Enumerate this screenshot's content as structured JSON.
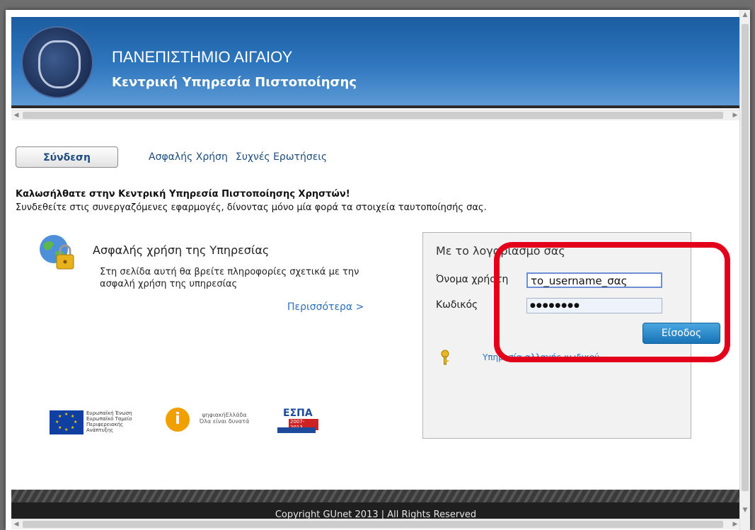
{
  "header": {
    "title": "ΠΑΝΕΠΙΣΤΗΜΙΟ ΑΙΓΑΙΟΥ",
    "subtitle": "Κεντρική Υπηρεσία Πιστοποίησης"
  },
  "nav": {
    "login_tab": "Σύνδεση",
    "secure_use": "Ασφαλής Χρήση",
    "faq": "Συχνές Ερωτήσεις"
  },
  "welcome": {
    "heading": "Καλωσήλθατε στην Κεντρική Υπηρεσία Πιστοποίησης Χρηστών!",
    "text": "Συνδεθείτε στις συνεργαζόμενες εφαρμογές, δίνοντας μόνο μία φορά τα στοιχεία ταυτοποίησής σας."
  },
  "secure": {
    "title": "Ασφαλής χρήση της Υπηρεσίας",
    "description": "Στη σελίδα αυτή θα βρείτε πληροφορίες σχετικά με την ασφαλή χρήση της υπηρεσίας",
    "more": "Περισσότερα >"
  },
  "login": {
    "title": "Με το λογαριασμό σας",
    "username_label": "Όνομα χρήστη",
    "username_value": "το_username_σας",
    "password_label": "Κωδικός",
    "password_value": "●●●●●●●●",
    "submit": "Είσοδος",
    "help_link": "Υπηρεσία αλλαγής κωδικού"
  },
  "logos": {
    "eu_text": "Ευρωπαϊκή Ένωση Ευρωπαϊκό Ταμείο Περιφερειακής Ανάπτυξης",
    "digital_brand": "ψηφιακήΕλλάδα",
    "digital_tagline": "Όλα είναι δυνατά",
    "espa": "ΕΣΠΑ",
    "espa_years": "2007-2013"
  },
  "footer": {
    "copyright": "Copyright GUnet 2013 | All Rights Reserved"
  }
}
